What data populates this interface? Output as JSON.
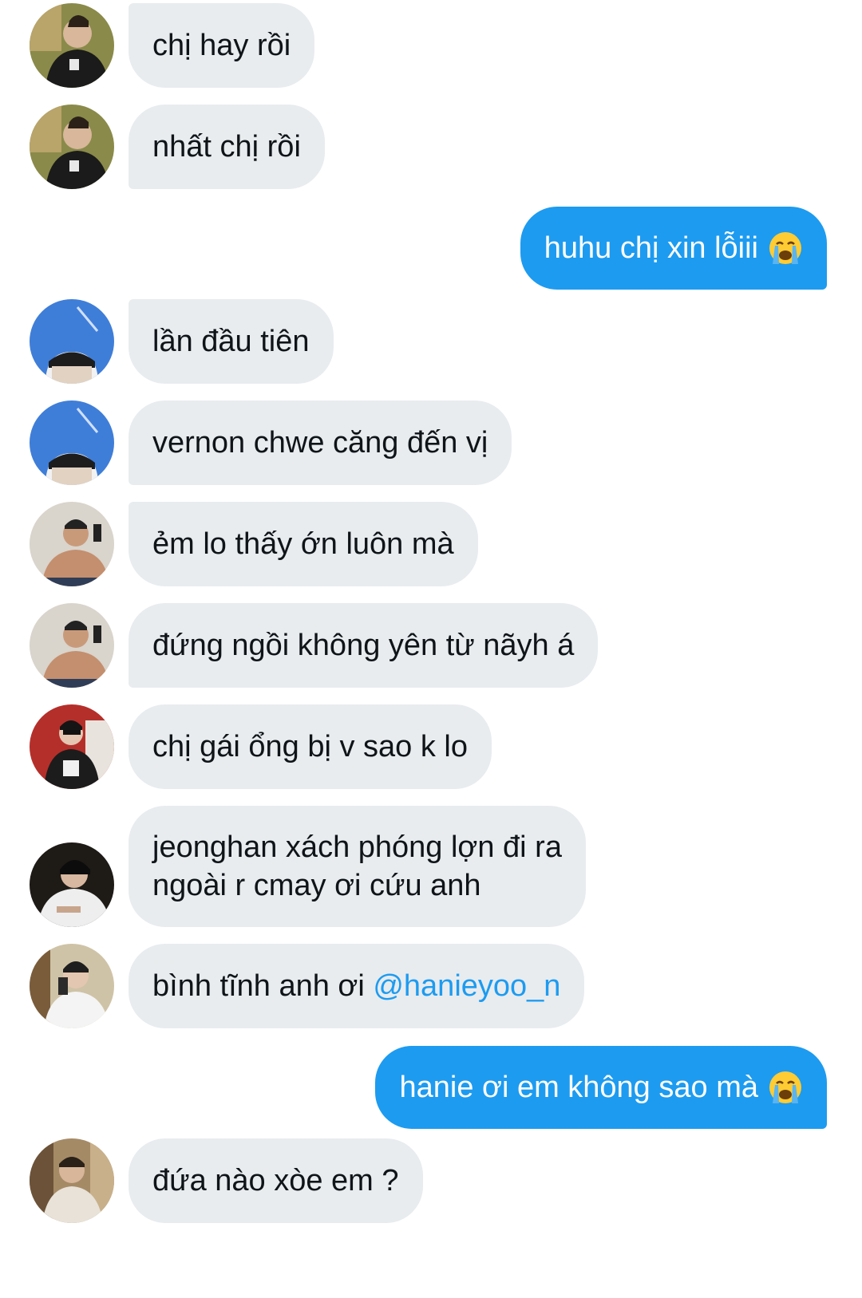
{
  "messages": [
    {
      "from": "other",
      "avatar": "avatar-jacket-man",
      "text": "chị hay rồi"
    },
    {
      "from": "other",
      "avatar": "avatar-jacket-man",
      "text": "nhất chị rồi"
    },
    {
      "from": "me",
      "text": "huhu chị xin lỗiii",
      "emoji": "loudly-crying-face-icon"
    },
    {
      "from": "other",
      "avatar": "avatar-sky-beanie",
      "text": "lần đầu tiên"
    },
    {
      "from": "other",
      "avatar": "avatar-sky-beanie",
      "text": "vernon chwe căng đến vị"
    },
    {
      "from": "other",
      "avatar": "avatar-mirror-selfie",
      "text": "ẻm lo thấy ớn luôn mà"
    },
    {
      "from": "other",
      "avatar": "avatar-mirror-selfie",
      "text": "đứng ngồi không yên từ nãyh á"
    },
    {
      "from": "other",
      "avatar": "avatar-red-store",
      "text": "chị gái ổng bị v sao k lo"
    },
    {
      "from": "other",
      "avatar": "avatar-dark-white-shirt",
      "text": "jeonghan xách phóng lợn đi ra\nngoài r cmay ơi cứu anh"
    },
    {
      "from": "other",
      "avatar": "avatar-phone-selfie",
      "text": "bình tĩnh anh ơi ",
      "mention": "@hanieyoo_n"
    },
    {
      "from": "me",
      "text": "hanie ơi em không sao mà",
      "emoji": "loudly-crying-face-icon"
    },
    {
      "from": "other",
      "avatar": "avatar-hallway-man",
      "text": "đứa nào xòe em ?"
    }
  ],
  "colors": {
    "my_bubble": "#1d9bf0",
    "their_bubble": "#e8ecef",
    "mention": "#1d9bf0"
  }
}
